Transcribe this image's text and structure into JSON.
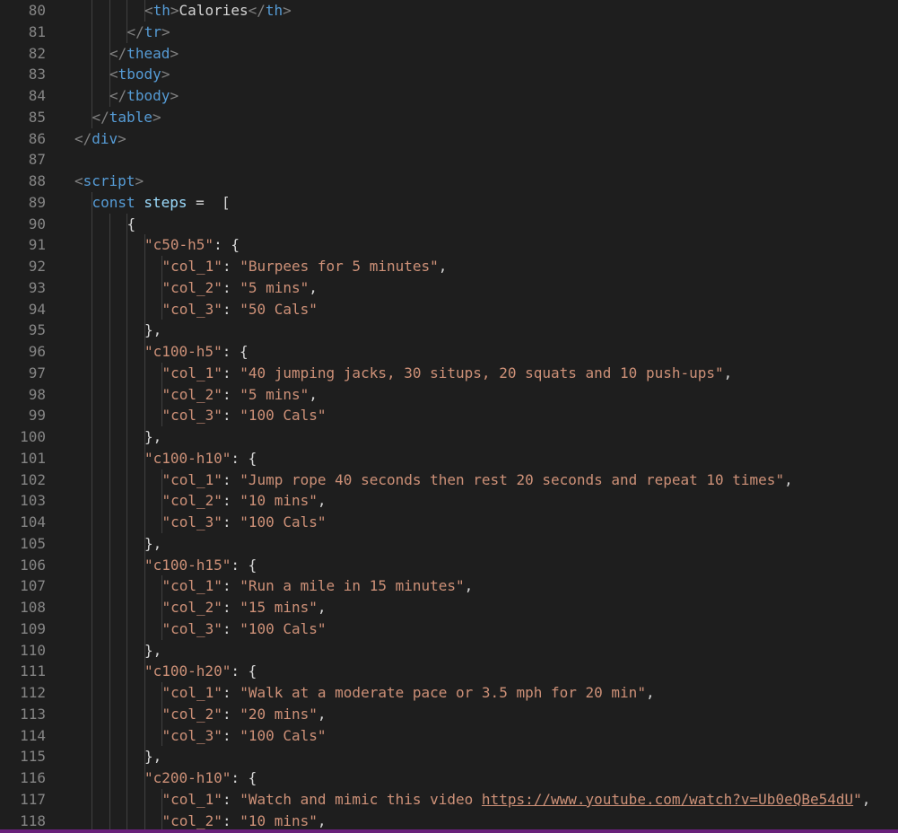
{
  "editor": {
    "lines": [
      {
        "num": "80",
        "indent": 4,
        "tokens": [
          [
            "c-br",
            "<"
          ],
          [
            "c-tag",
            "th"
          ],
          [
            "c-br",
            ">"
          ],
          [
            "c-txt",
            "Calories"
          ],
          [
            "c-br",
            "</"
          ],
          [
            "c-tag",
            "th"
          ],
          [
            "c-br",
            ">"
          ]
        ]
      },
      {
        "num": "81",
        "indent": 3,
        "tokens": [
          [
            "c-br",
            "</"
          ],
          [
            "c-tag",
            "tr"
          ],
          [
            "c-br",
            ">"
          ]
        ]
      },
      {
        "num": "82",
        "indent": 2,
        "tokens": [
          [
            "c-br",
            "</"
          ],
          [
            "c-tag",
            "thead"
          ],
          [
            "c-br",
            ">"
          ]
        ]
      },
      {
        "num": "83",
        "indent": 2,
        "tokens": [
          [
            "c-br",
            "<"
          ],
          [
            "c-tag",
            "tbody"
          ],
          [
            "c-br",
            ">"
          ]
        ]
      },
      {
        "num": "84",
        "indent": 2,
        "tokens": [
          [
            "c-br",
            "</"
          ],
          [
            "c-tag",
            "tbody"
          ],
          [
            "c-br",
            ">"
          ]
        ]
      },
      {
        "num": "85",
        "indent": 1,
        "tokens": [
          [
            "c-br",
            "</"
          ],
          [
            "c-tag",
            "table"
          ],
          [
            "c-br",
            ">"
          ]
        ]
      },
      {
        "num": "86",
        "indent": 0,
        "tokens": [
          [
            "c-br",
            "</"
          ],
          [
            "c-tag",
            "div"
          ],
          [
            "c-br",
            ">"
          ]
        ]
      },
      {
        "num": "87",
        "indent": 0,
        "tokens": []
      },
      {
        "num": "88",
        "indent": 0,
        "tokens": [
          [
            "c-br",
            "<"
          ],
          [
            "c-tag",
            "script"
          ],
          [
            "c-br",
            ">"
          ]
        ]
      },
      {
        "num": "89",
        "indent": 1,
        "tokens": [
          [
            "c-kw",
            "const"
          ],
          [
            "c-op",
            " "
          ],
          [
            "c-var",
            "steps"
          ],
          [
            "c-op",
            " =  ["
          ]
        ]
      },
      {
        "num": "90",
        "indent": 3,
        "tokens": [
          [
            "c-op",
            "{"
          ]
        ]
      },
      {
        "num": "91",
        "indent": 4,
        "tokens": [
          [
            "c-str",
            "\"c50-h5\""
          ],
          [
            "c-op",
            ": {"
          ]
        ]
      },
      {
        "num": "92",
        "indent": 5,
        "tokens": [
          [
            "c-str",
            "\"col_1\""
          ],
          [
            "c-op",
            ": "
          ],
          [
            "c-str",
            "\"Burpees for 5 minutes\""
          ],
          [
            "c-op",
            ","
          ]
        ]
      },
      {
        "num": "93",
        "indent": 5,
        "tokens": [
          [
            "c-str",
            "\"col_2\""
          ],
          [
            "c-op",
            ": "
          ],
          [
            "c-str",
            "\"5 mins\""
          ],
          [
            "c-op",
            ","
          ]
        ]
      },
      {
        "num": "94",
        "indent": 5,
        "tokens": [
          [
            "c-str",
            "\"col_3\""
          ],
          [
            "c-op",
            ": "
          ],
          [
            "c-str",
            "\"50 Cals\""
          ]
        ]
      },
      {
        "num": "95",
        "indent": 4,
        "tokens": [
          [
            "c-op",
            "},"
          ]
        ]
      },
      {
        "num": "96",
        "indent": 4,
        "tokens": [
          [
            "c-str",
            "\"c100-h5\""
          ],
          [
            "c-op",
            ": {"
          ]
        ]
      },
      {
        "num": "97",
        "indent": 5,
        "tokens": [
          [
            "c-str",
            "\"col_1\""
          ],
          [
            "c-op",
            ": "
          ],
          [
            "c-str",
            "\"40 jumping jacks, 30 situps, 20 squats and 10 push-ups\""
          ],
          [
            "c-op",
            ","
          ]
        ]
      },
      {
        "num": "98",
        "indent": 5,
        "tokens": [
          [
            "c-str",
            "\"col_2\""
          ],
          [
            "c-op",
            ": "
          ],
          [
            "c-str",
            "\"5 mins\""
          ],
          [
            "c-op",
            ","
          ]
        ]
      },
      {
        "num": "99",
        "indent": 5,
        "tokens": [
          [
            "c-str",
            "\"col_3\""
          ],
          [
            "c-op",
            ": "
          ],
          [
            "c-str",
            "\"100 Cals\""
          ]
        ]
      },
      {
        "num": "100",
        "indent": 4,
        "tokens": [
          [
            "c-op",
            "},"
          ]
        ]
      },
      {
        "num": "101",
        "indent": 4,
        "tokens": [
          [
            "c-str",
            "\"c100-h10\""
          ],
          [
            "c-op",
            ": {"
          ]
        ]
      },
      {
        "num": "102",
        "indent": 5,
        "tokens": [
          [
            "c-str",
            "\"col_1\""
          ],
          [
            "c-op",
            ": "
          ],
          [
            "c-str",
            "\"Jump rope 40 seconds then rest 20 seconds and repeat 10 times\""
          ],
          [
            "c-op",
            ","
          ]
        ]
      },
      {
        "num": "103",
        "indent": 5,
        "tokens": [
          [
            "c-str",
            "\"col_2\""
          ],
          [
            "c-op",
            ": "
          ],
          [
            "c-str",
            "\"10 mins\""
          ],
          [
            "c-op",
            ","
          ]
        ]
      },
      {
        "num": "104",
        "indent": 5,
        "tokens": [
          [
            "c-str",
            "\"col_3\""
          ],
          [
            "c-op",
            ": "
          ],
          [
            "c-str",
            "\"100 Cals\""
          ]
        ]
      },
      {
        "num": "105",
        "indent": 4,
        "tokens": [
          [
            "c-op",
            "},"
          ]
        ]
      },
      {
        "num": "106",
        "indent": 4,
        "tokens": [
          [
            "c-str",
            "\"c100-h15\""
          ],
          [
            "c-op",
            ": {"
          ]
        ]
      },
      {
        "num": "107",
        "indent": 5,
        "tokens": [
          [
            "c-str",
            "\"col_1\""
          ],
          [
            "c-op",
            ": "
          ],
          [
            "c-str",
            "\"Run a mile in 15 minutes\""
          ],
          [
            "c-op",
            ","
          ]
        ]
      },
      {
        "num": "108",
        "indent": 5,
        "tokens": [
          [
            "c-str",
            "\"col_2\""
          ],
          [
            "c-op",
            ": "
          ],
          [
            "c-str",
            "\"15 mins\""
          ],
          [
            "c-op",
            ","
          ]
        ]
      },
      {
        "num": "109",
        "indent": 5,
        "tokens": [
          [
            "c-str",
            "\"col_3\""
          ],
          [
            "c-op",
            ": "
          ],
          [
            "c-str",
            "\"100 Cals\""
          ]
        ]
      },
      {
        "num": "110",
        "indent": 4,
        "tokens": [
          [
            "c-op",
            "},"
          ]
        ]
      },
      {
        "num": "111",
        "indent": 4,
        "tokens": [
          [
            "c-str",
            "\"c100-h20\""
          ],
          [
            "c-op",
            ": {"
          ]
        ]
      },
      {
        "num": "112",
        "indent": 5,
        "tokens": [
          [
            "c-str",
            "\"col_1\""
          ],
          [
            "c-op",
            ": "
          ],
          [
            "c-str",
            "\"Walk at a moderate pace or 3.5 mph for 20 min\""
          ],
          [
            "c-op",
            ","
          ]
        ]
      },
      {
        "num": "113",
        "indent": 5,
        "tokens": [
          [
            "c-str",
            "\"col_2\""
          ],
          [
            "c-op",
            ": "
          ],
          [
            "c-str",
            "\"20 mins\""
          ],
          [
            "c-op",
            ","
          ]
        ]
      },
      {
        "num": "114",
        "indent": 5,
        "tokens": [
          [
            "c-str",
            "\"col_3\""
          ],
          [
            "c-op",
            ": "
          ],
          [
            "c-str",
            "\"100 Cals\""
          ]
        ]
      },
      {
        "num": "115",
        "indent": 4,
        "tokens": [
          [
            "c-op",
            "},"
          ]
        ]
      },
      {
        "num": "116",
        "indent": 4,
        "tokens": [
          [
            "c-str",
            "\"c200-h10\""
          ],
          [
            "c-op",
            ": {"
          ]
        ]
      },
      {
        "num": "117",
        "indent": 5,
        "tokens": [
          [
            "c-str",
            "\"col_1\""
          ],
          [
            "c-op",
            ": "
          ],
          [
            "c-str",
            "\"Watch and mimic this video "
          ],
          [
            "c-link",
            "https://www.youtube.com/watch?v=Ub0eQBe54dU"
          ],
          [
            "c-str",
            "\""
          ],
          [
            "c-op",
            ","
          ]
        ]
      },
      {
        "num": "118",
        "indent": 5,
        "tokens": [
          [
            "c-str",
            "\"col_2\""
          ],
          [
            "c-op",
            ": "
          ],
          [
            "c-str",
            "\"10 mins\""
          ],
          [
            "c-op",
            ","
          ]
        ]
      }
    ]
  },
  "colors": {
    "background": "#1e1e1e",
    "line_number": "#858585",
    "tag": "#569cd6",
    "string": "#ce9178",
    "variable": "#9cdcfe",
    "status_bar": "#68217a"
  }
}
